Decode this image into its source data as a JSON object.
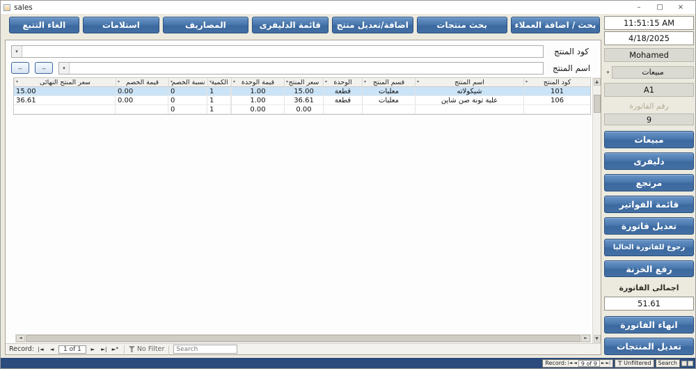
{
  "window": {
    "title": "sales"
  },
  "titlebar": {
    "minimize": "–",
    "maximize": "□",
    "close": "×"
  },
  "icons": {
    "dropdown": "▾",
    "up_arrow": "▲",
    "down_arrow": "▼",
    "left_arrow": "◄",
    "right_arrow": "►"
  },
  "colors": {
    "accent_blue": "#4472a8",
    "selected_row": "#cbe3f6",
    "status_bar_blue": "#2b4b7c"
  },
  "toolbar": {
    "buttons": [
      {
        "label": "بحث / اضافة العملاء"
      },
      {
        "label": "بحث منتجات"
      },
      {
        "label": "اضافة/تعديل منتج"
      },
      {
        "label": "قائمة الدليفرى"
      },
      {
        "label": "المصاريف"
      },
      {
        "label": "استلامات"
      },
      {
        "label": "الغاء التتبع"
      }
    ]
  },
  "invoice_form": {
    "product_code_label": "كود المنتج",
    "product_code_value": "",
    "product_name_label": "اسم المنتج",
    "product_name_value": "",
    "mini_button_1": "–",
    "mini_button_2": "–"
  },
  "table": {
    "columns": [
      "كود المنتج",
      "اسم المنتج",
      "قسم المنتج",
      "الوحدة",
      "سعر المنتج",
      "قيمة الوحدة",
      "الكمية",
      "نسبة الخصم",
      "قيمة الخصم",
      "سعر المنتج النهائى"
    ],
    "rows": [
      {
        "cells": [
          "101",
          "شيكولاته",
          "معلبات",
          "قطعة",
          "15.00",
          "1.00",
          "1",
          "0",
          "0.00",
          "15.00"
        ]
      },
      {
        "cells": [
          "106",
          "علبة تونة صن شاين",
          "معلبات",
          "قطعة",
          "36.61",
          "1.00",
          "1",
          "0",
          "0.00",
          "36.61"
        ]
      },
      {
        "cells": [
          "",
          "",
          "",
          "",
          "0.00",
          "0.00",
          "1",
          "0",
          "",
          ""
        ]
      }
    ]
  },
  "record_nav": {
    "label": "Record:",
    "first": "|◄",
    "prev": "◄",
    "position": "1 of 1",
    "next": "►",
    "last": "►|",
    "new_record": "►*",
    "filter_label": "No Filter",
    "search_placeholder": "Search"
  },
  "sidebar": {
    "time": "11:51:15 AM",
    "date": "4/18/2025",
    "user": "Mohamed",
    "mode": "مبيعات",
    "station": "A1",
    "invoice_number_label": "رقم الفاتورة",
    "invoice_number": "9",
    "buttons": [
      {
        "label": "مبيعات"
      },
      {
        "label": "دليفرى"
      },
      {
        "label": "مرتجع"
      },
      {
        "label": "قائمة الفواتير"
      },
      {
        "label": "تعديل فاتورة"
      },
      {
        "label": "رجوع للفاتورة الحاليا"
      },
      {
        "label": "رفع الخزنة"
      }
    ],
    "invoice_total_label": "اجمالى الفاتورة",
    "invoice_total": "51.61",
    "finish_invoice_label": "انهاء الفاتورة",
    "edit_products_label": "تعديل المنتجات"
  },
  "status_bar": {
    "label": "Record:",
    "first": "|◄",
    "prev": "◄",
    "position": "9 of 9",
    "next": "►",
    "last": "►|",
    "filter_state": "Unfiltered",
    "search_label": "Search"
  }
}
